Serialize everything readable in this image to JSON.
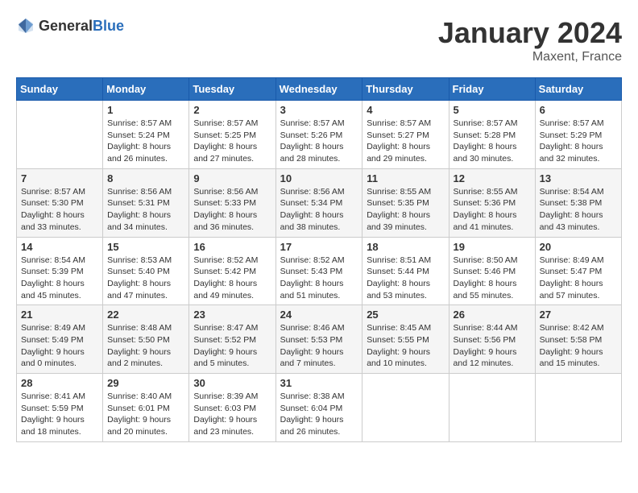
{
  "header": {
    "logo_general": "General",
    "logo_blue": "Blue",
    "month_title": "January 2024",
    "location": "Maxent, France"
  },
  "columns": [
    "Sunday",
    "Monday",
    "Tuesday",
    "Wednesday",
    "Thursday",
    "Friday",
    "Saturday"
  ],
  "weeks": [
    {
      "days": [
        {
          "number": "",
          "info": ""
        },
        {
          "number": "1",
          "info": "Sunrise: 8:57 AM\nSunset: 5:24 PM\nDaylight: 8 hours\nand 26 minutes."
        },
        {
          "number": "2",
          "info": "Sunrise: 8:57 AM\nSunset: 5:25 PM\nDaylight: 8 hours\nand 27 minutes."
        },
        {
          "number": "3",
          "info": "Sunrise: 8:57 AM\nSunset: 5:26 PM\nDaylight: 8 hours\nand 28 minutes."
        },
        {
          "number": "4",
          "info": "Sunrise: 8:57 AM\nSunset: 5:27 PM\nDaylight: 8 hours\nand 29 minutes."
        },
        {
          "number": "5",
          "info": "Sunrise: 8:57 AM\nSunset: 5:28 PM\nDaylight: 8 hours\nand 30 minutes."
        },
        {
          "number": "6",
          "info": "Sunrise: 8:57 AM\nSunset: 5:29 PM\nDaylight: 8 hours\nand 32 minutes."
        }
      ]
    },
    {
      "days": [
        {
          "number": "7",
          "info": "Sunrise: 8:57 AM\nSunset: 5:30 PM\nDaylight: 8 hours\nand 33 minutes."
        },
        {
          "number": "8",
          "info": "Sunrise: 8:56 AM\nSunset: 5:31 PM\nDaylight: 8 hours\nand 34 minutes."
        },
        {
          "number": "9",
          "info": "Sunrise: 8:56 AM\nSunset: 5:33 PM\nDaylight: 8 hours\nand 36 minutes."
        },
        {
          "number": "10",
          "info": "Sunrise: 8:56 AM\nSunset: 5:34 PM\nDaylight: 8 hours\nand 38 minutes."
        },
        {
          "number": "11",
          "info": "Sunrise: 8:55 AM\nSunset: 5:35 PM\nDaylight: 8 hours\nand 39 minutes."
        },
        {
          "number": "12",
          "info": "Sunrise: 8:55 AM\nSunset: 5:36 PM\nDaylight: 8 hours\nand 41 minutes."
        },
        {
          "number": "13",
          "info": "Sunrise: 8:54 AM\nSunset: 5:38 PM\nDaylight: 8 hours\nand 43 minutes."
        }
      ]
    },
    {
      "days": [
        {
          "number": "14",
          "info": "Sunrise: 8:54 AM\nSunset: 5:39 PM\nDaylight: 8 hours\nand 45 minutes."
        },
        {
          "number": "15",
          "info": "Sunrise: 8:53 AM\nSunset: 5:40 PM\nDaylight: 8 hours\nand 47 minutes."
        },
        {
          "number": "16",
          "info": "Sunrise: 8:52 AM\nSunset: 5:42 PM\nDaylight: 8 hours\nand 49 minutes."
        },
        {
          "number": "17",
          "info": "Sunrise: 8:52 AM\nSunset: 5:43 PM\nDaylight: 8 hours\nand 51 minutes."
        },
        {
          "number": "18",
          "info": "Sunrise: 8:51 AM\nSunset: 5:44 PM\nDaylight: 8 hours\nand 53 minutes."
        },
        {
          "number": "19",
          "info": "Sunrise: 8:50 AM\nSunset: 5:46 PM\nDaylight: 8 hours\nand 55 minutes."
        },
        {
          "number": "20",
          "info": "Sunrise: 8:49 AM\nSunset: 5:47 PM\nDaylight: 8 hours\nand 57 minutes."
        }
      ]
    },
    {
      "days": [
        {
          "number": "21",
          "info": "Sunrise: 8:49 AM\nSunset: 5:49 PM\nDaylight: 9 hours\nand 0 minutes."
        },
        {
          "number": "22",
          "info": "Sunrise: 8:48 AM\nSunset: 5:50 PM\nDaylight: 9 hours\nand 2 minutes."
        },
        {
          "number": "23",
          "info": "Sunrise: 8:47 AM\nSunset: 5:52 PM\nDaylight: 9 hours\nand 5 minutes."
        },
        {
          "number": "24",
          "info": "Sunrise: 8:46 AM\nSunset: 5:53 PM\nDaylight: 9 hours\nand 7 minutes."
        },
        {
          "number": "25",
          "info": "Sunrise: 8:45 AM\nSunset: 5:55 PM\nDaylight: 9 hours\nand 10 minutes."
        },
        {
          "number": "26",
          "info": "Sunrise: 8:44 AM\nSunset: 5:56 PM\nDaylight: 9 hours\nand 12 minutes."
        },
        {
          "number": "27",
          "info": "Sunrise: 8:42 AM\nSunset: 5:58 PM\nDaylight: 9 hours\nand 15 minutes."
        }
      ]
    },
    {
      "days": [
        {
          "number": "28",
          "info": "Sunrise: 8:41 AM\nSunset: 5:59 PM\nDaylight: 9 hours\nand 18 minutes."
        },
        {
          "number": "29",
          "info": "Sunrise: 8:40 AM\nSunset: 6:01 PM\nDaylight: 9 hours\nand 20 minutes."
        },
        {
          "number": "30",
          "info": "Sunrise: 8:39 AM\nSunset: 6:03 PM\nDaylight: 9 hours\nand 23 minutes."
        },
        {
          "number": "31",
          "info": "Sunrise: 8:38 AM\nSunset: 6:04 PM\nDaylight: 9 hours\nand 26 minutes."
        },
        {
          "number": "",
          "info": ""
        },
        {
          "number": "",
          "info": ""
        },
        {
          "number": "",
          "info": ""
        }
      ]
    }
  ]
}
